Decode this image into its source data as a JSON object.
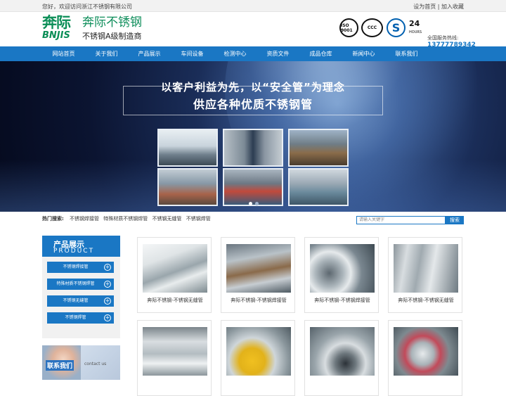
{
  "topbar": {
    "welcome": "您好，欢迎访问浙江不锈钢有限公司",
    "set_home": "设为首页",
    "separator": " | ",
    "add_fav": "加入收藏"
  },
  "header": {
    "logo_cn": "奔际",
    "logo_en": "BNJIS",
    "brand_name": "奔际不锈钢",
    "brand_slogan": "不锈钢A级制造商",
    "cert_iso": "ISO 9001",
    "cert_ccc": "CCC",
    "cert_s": "S",
    "h24": "24",
    "h24_sub": "HOURS",
    "hotline_label": "全国服务热线:",
    "hotline_number": "13777789342"
  },
  "nav": {
    "items": [
      "网站首页",
      "关于我们",
      "产品展示",
      "车间设备",
      "检测中心",
      "资质文件",
      "成品仓库",
      "新闻中心",
      "联系我们"
    ]
  },
  "banner": {
    "line1": "以客户利益为先，以“安全管”为理念",
    "line2": "供应各种优质不锈钢管"
  },
  "hot_search": {
    "label": "热门搜索:",
    "terms": [
      "不锈钢焊接管",
      "特殊材质不锈钢焊管",
      "不锈钢无缝管",
      "不锈钢焊管"
    ],
    "placeholder": "请输入关键字",
    "button": "搜索"
  },
  "sidebar": {
    "title_cn": "产品展示",
    "title_en": "PRODUCT",
    "categories": [
      "不锈钢焊接管",
      "特殊材质不锈钢焊管",
      "不锈钢无缝管",
      "不锈钢焊管"
    ],
    "contact_label": "联系我们",
    "contact_sub": "contact us"
  },
  "products": [
    {
      "caption": "奔际不锈钢-不锈钢无缝管"
    },
    {
      "caption": "奔际不锈钢-不锈钢焊接管"
    },
    {
      "caption": "奔际不锈钢-不锈钢焊接管"
    },
    {
      "caption": "奔际不锈钢-不锈钢无缝管"
    },
    {
      "caption": ""
    },
    {
      "caption": ""
    },
    {
      "caption": ""
    },
    {
      "caption": ""
    }
  ],
  "colors": {
    "brand_green": "#0b8e57",
    "nav_blue": "#1a77c4",
    "hotline_blue": "#1677c4"
  }
}
